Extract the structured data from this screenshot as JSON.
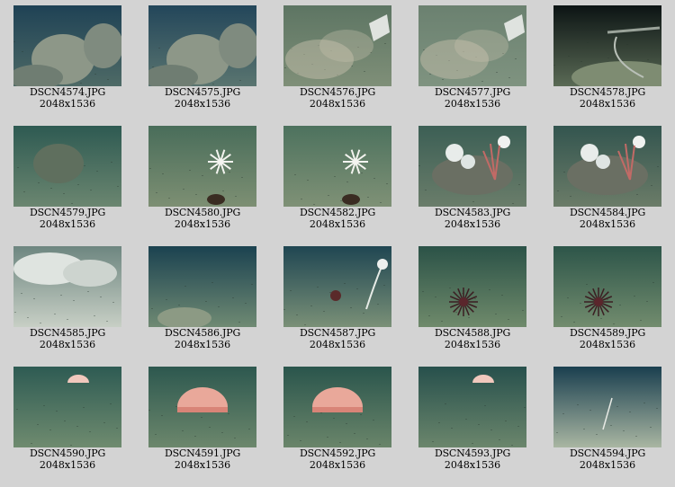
{
  "thumbnails": [
    {
      "file": "DSCN4574.JPG",
      "dims": "2048x1536",
      "scene": "rocky-boulder",
      "top": "#1f4255",
      "bottom": "#4e6a66"
    },
    {
      "file": "DSCN4575.JPG",
      "dims": "2048x1536",
      "scene": "rocky-boulder",
      "top": "#23465a",
      "bottom": "#5a7570"
    },
    {
      "file": "DSCN4576.JPG",
      "dims": "2048x1536",
      "scene": "sediment-plume",
      "top": "#5d7563",
      "bottom": "#7f8f78"
    },
    {
      "file": "DSCN4577.JPG",
      "dims": "2048x1536",
      "scene": "sediment-plume",
      "top": "#6b8170",
      "bottom": "#7f9380"
    },
    {
      "file": "DSCN4578.JPG",
      "dims": "2048x1536",
      "scene": "dark-probe",
      "top": "#0c1414",
      "bottom": "#5a6a55"
    },
    {
      "file": "DSCN4579.JPG",
      "dims": "2048x1536",
      "scene": "seafloor-rock",
      "top": "#2e5a52",
      "bottom": "#6b8670"
    },
    {
      "file": "DSCN4580.JPG",
      "dims": "2048x1536",
      "scene": "crinoid",
      "top": "#496d5a",
      "bottom": "#7d8f73"
    },
    {
      "file": "DSCN4582.JPG",
      "dims": "2048x1536",
      "scene": "crinoid",
      "top": "#4d725e",
      "bottom": "#7f9176"
    },
    {
      "file": "DSCN4583.JPG",
      "dims": "2048x1536",
      "scene": "coral-rock",
      "top": "#3c5f55",
      "bottom": "#6a7d6a"
    },
    {
      "file": "DSCN4584.JPG",
      "dims": "2048x1536",
      "scene": "coral-rock",
      "top": "#33554f",
      "bottom": "#6b7c68"
    },
    {
      "file": "DSCN4585.JPG",
      "dims": "2048x1536",
      "scene": "white-rubble",
      "top": "#6d8680",
      "bottom": "#c7cfc5"
    },
    {
      "file": "DSCN4586.JPG",
      "dims": "2048x1536",
      "scene": "flat-seafloor",
      "top": "#1b4250",
      "bottom": "#6f8a73"
    },
    {
      "file": "DSCN4587.JPG",
      "dims": "2048x1536",
      "scene": "anemone-stalk",
      "top": "#1f4652",
      "bottom": "#7a9077"
    },
    {
      "file": "DSCN4588.JPG",
      "dims": "2048x1536",
      "scene": "urchin",
      "top": "#2b5247",
      "bottom": "#6f8a6b"
    },
    {
      "file": "DSCN4589.JPG",
      "dims": "2048x1536",
      "scene": "urchin",
      "top": "#2d5549",
      "bottom": "#728c6e"
    },
    {
      "file": "DSCN4590.JPG",
      "dims": "2048x1536",
      "scene": "jellyfish-small",
      "top": "#2e5b53",
      "bottom": "#6f8b6f"
    },
    {
      "file": "DSCN4591.JPG",
      "dims": "2048x1536",
      "scene": "jellyfish-large",
      "top": "#2d584f",
      "bottom": "#6c876c"
    },
    {
      "file": "DSCN4592.JPG",
      "dims": "2048x1536",
      "scene": "jellyfish-large",
      "top": "#2a554c",
      "bottom": "#6a856a"
    },
    {
      "file": "DSCN4593.JPG",
      "dims": "2048x1536",
      "scene": "jellyfish-small",
      "top": "#27504c",
      "bottom": "#6b866c"
    },
    {
      "file": "DSCN4594.JPG",
      "dims": "2048x1536",
      "scene": "pale-seafloor",
      "top": "#1a3f4f",
      "bottom": "#a9b6a2"
    }
  ]
}
